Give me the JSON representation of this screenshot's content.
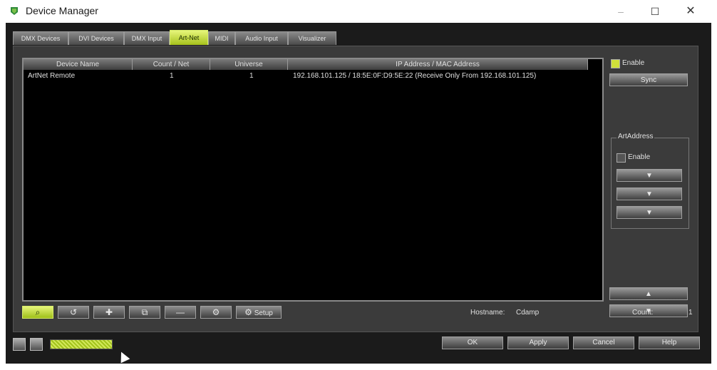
{
  "window": {
    "title": "Device Manager",
    "min_icon": "–",
    "max_icon": "☐",
    "close_icon": "✕"
  },
  "tabs": [
    {
      "label": "DMX Devices"
    },
    {
      "label": "DVI Devices"
    },
    {
      "label": "DMX Input"
    },
    {
      "label": "Art-Net"
    },
    {
      "label": "MIDI"
    },
    {
      "label": "Audio Input"
    },
    {
      "label": "Visualizer"
    }
  ],
  "active_tab": "Art-Net",
  "table": {
    "headers": [
      "Device Name",
      "Count / Net",
      "Universe",
      "IP Address / MAC Address"
    ],
    "rows": [
      {
        "device_name": "ArtNet Remote",
        "count_net": "1",
        "universe": "1",
        "address": "192.168.101.125 / 18:5E:0F:D9:5E:22 (Receive Only From 192.168.101.125)"
      }
    ]
  },
  "side": {
    "enable_label": "Enable",
    "sync_label": "Sync",
    "art_address_title": "ArtAddress",
    "art_address_enable_label": "Enable",
    "arrow_down": "▼",
    "arrow_up": "▲"
  },
  "toolbar": {
    "search_icon": "⌕",
    "refresh_icon": "↺",
    "add_icon": "✚",
    "copy_icon": "⧉",
    "remove_icon": "—",
    "settings_icon": "⚙",
    "settings2_icon": "⚙",
    "settings2_label": "Setup"
  },
  "info": {
    "hostname_label": "Hostname:",
    "hostname_value": "Cdamp",
    "count_label": "Count:",
    "count_value": "1"
  },
  "footer": {
    "ok": "OK",
    "apply": "Apply",
    "cancel": "Cancel",
    "help": "Help"
  },
  "colors": {
    "accent": "#bcd43a",
    "background": "#1b1b1b",
    "panel": "#3b3b3b"
  }
}
